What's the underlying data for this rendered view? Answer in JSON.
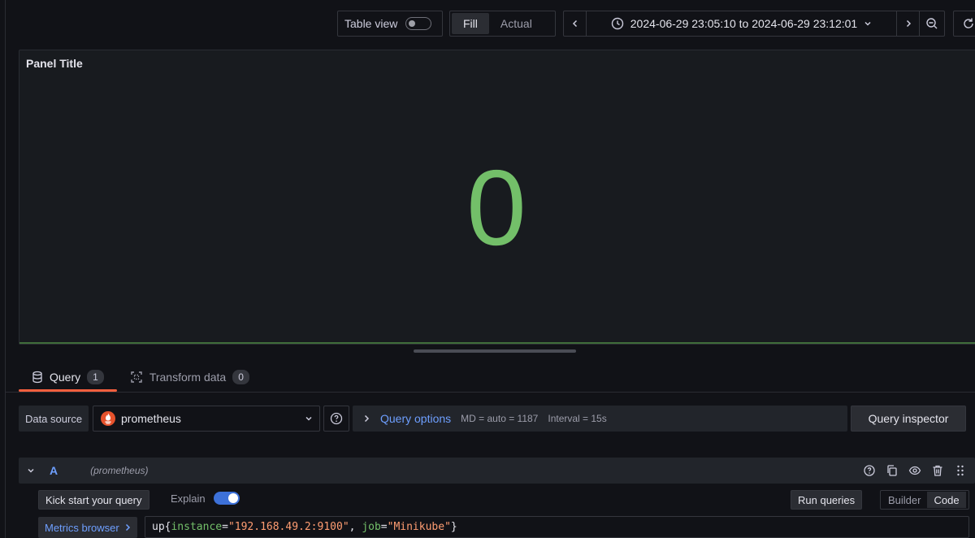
{
  "toolbar": {
    "table_view_label": "Table view",
    "fill_label": "Fill",
    "actual_label": "Actual",
    "time_range": "2024-06-29 23:05:10 to 2024-06-29 23:12:01"
  },
  "panel": {
    "title": "Panel Title",
    "value": "0",
    "value_color": "#73bf69"
  },
  "tabs": [
    {
      "label": "Query",
      "count": "1"
    },
    {
      "label": "Transform data",
      "count": "0"
    }
  ],
  "datasource": {
    "label": "Data source",
    "selected": "prometheus",
    "query_options_title": "Query options",
    "md": "MD = auto = 1187",
    "interval": "Interval = 15s",
    "inspector_label": "Query inspector"
  },
  "query": {
    "ref_id": "A",
    "ds_name": "(prometheus)",
    "kick_start_label": "Kick start your query",
    "explain_label": "Explain",
    "run_label": "Run queries",
    "mode_builder": "Builder",
    "mode_code": "Code",
    "metrics_browser_label": "Metrics browser",
    "expr": {
      "metric": "up",
      "open": "{",
      "label1": "instance",
      "eq1": "=",
      "value1": "\"192.168.49.2:9100\"",
      "sep": ", ",
      "label2": "job",
      "eq2": "=",
      "value2": "\"Minikube\"",
      "close": "}"
    }
  },
  "colors": {
    "accent_tab": "#f55f3e",
    "link_blue": "#6e9fff",
    "prometheus_orange": "#e6522c"
  }
}
